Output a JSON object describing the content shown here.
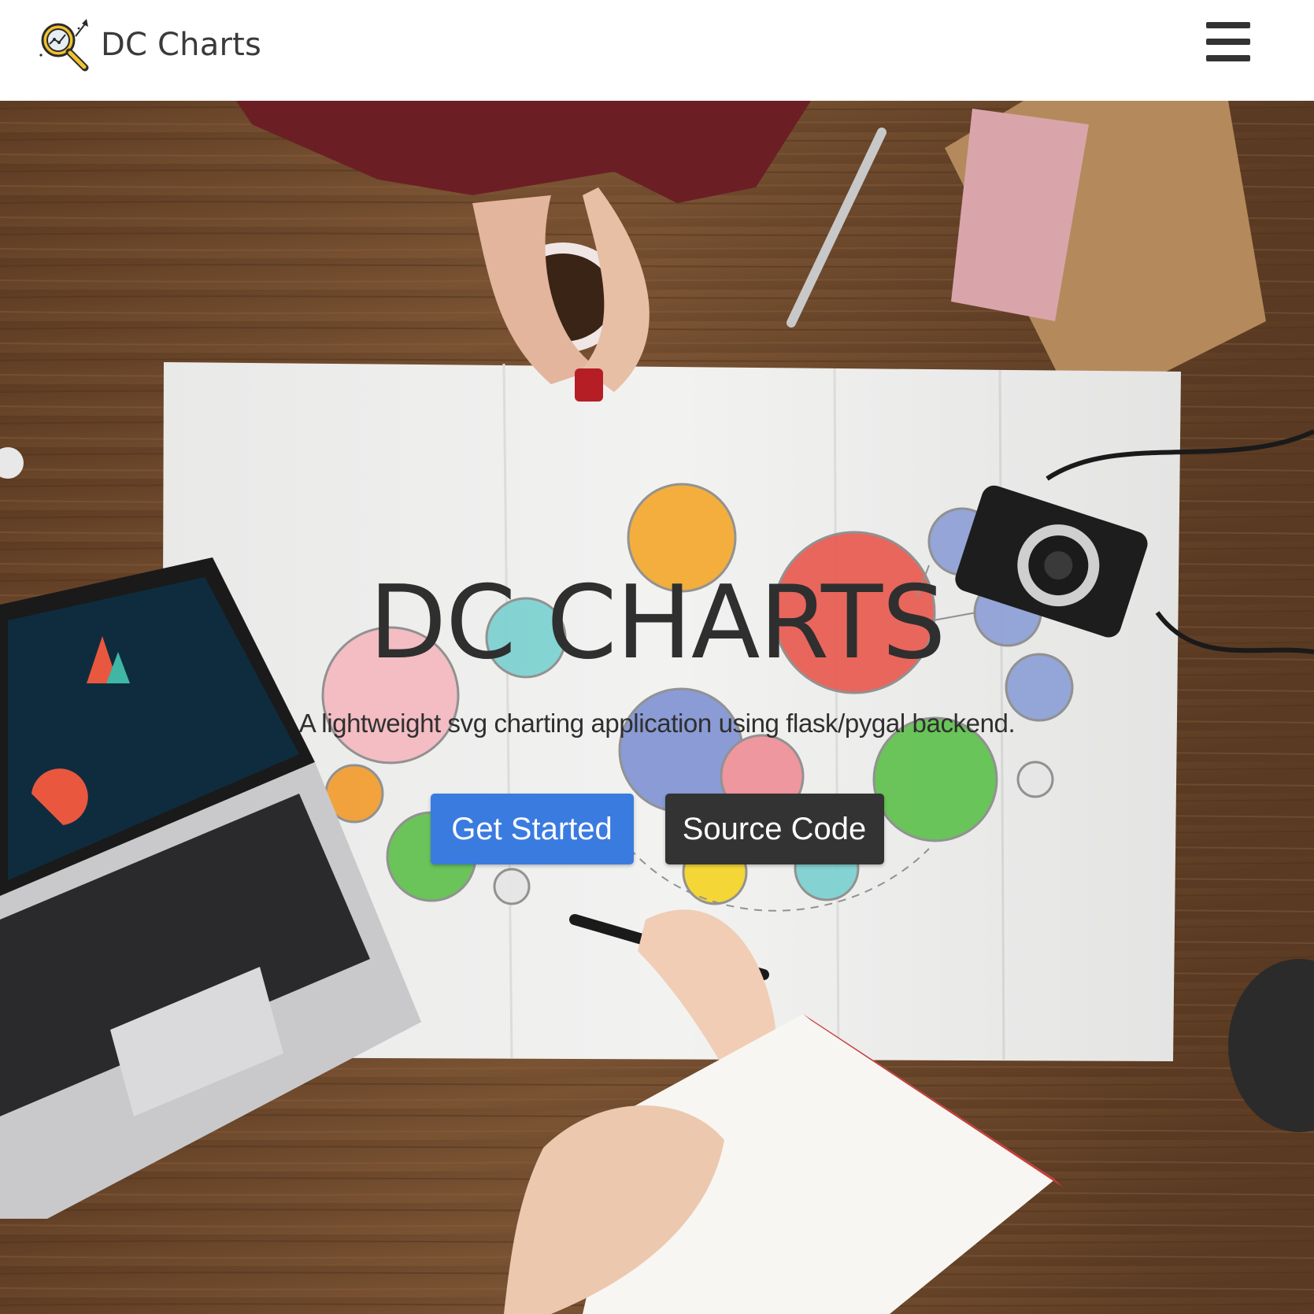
{
  "navbar": {
    "brand_text": "DC Charts",
    "logo_icon": "magnifier-chart-icon",
    "menu_icon": "hamburger-menu-icon"
  },
  "hero": {
    "title": "DC CHARTS",
    "subtitle": "A lightweight svg charting application using flask/pygal backend.",
    "primary_button": "Get Started",
    "secondary_button": "Source Code"
  },
  "colors": {
    "primary": "#3a7be0",
    "dark": "#333333",
    "text": "#2f2f2f",
    "wood": "#6d4a2e",
    "paper": "#ececeb"
  }
}
